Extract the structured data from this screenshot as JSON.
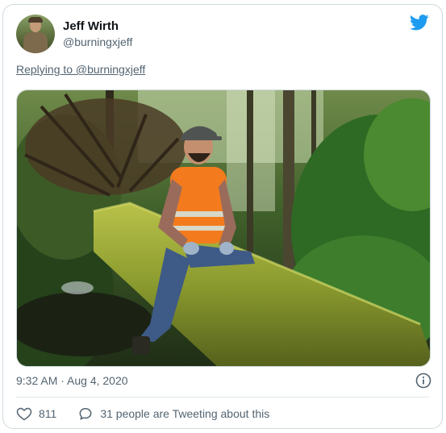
{
  "tweet": {
    "author_name": "Jeff Wirth",
    "author_handle": "@burningxjeff",
    "reply_text": "Replying to @burningxjeff",
    "timestamp": "9:32 AM · Aug 4, 2020",
    "like_count": "811",
    "tweeting_text": "31 people are Tweeting about this"
  },
  "icons": {
    "brand": "twitter-bird-icon",
    "info": "info-icon",
    "like": "heart-icon",
    "reply": "speech-bubble-icon"
  },
  "colors": {
    "brand_blue": "#1d9bf0",
    "secondary_text": "#536471",
    "border": "#cfd9de"
  }
}
